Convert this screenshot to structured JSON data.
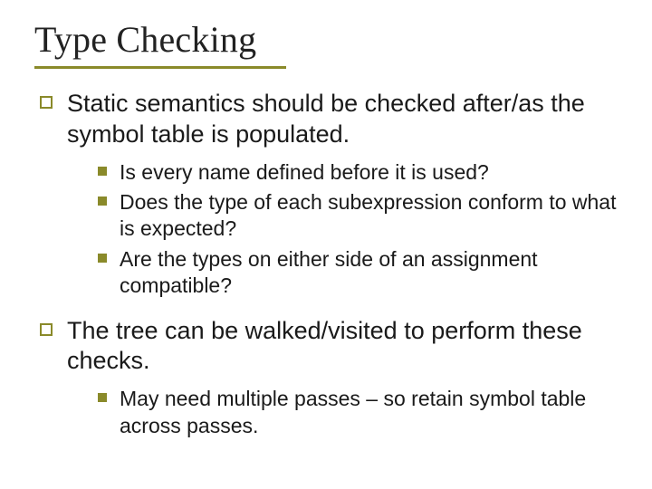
{
  "slide": {
    "title": "Type Checking",
    "points": [
      {
        "text": "Static semantics should be checked after/as the symbol table is populated.",
        "sub": [
          "Is every name defined before it is used?",
          "Does the type of each subexpression conform to what is expected?",
          "Are the types on either side of an assignment compatible?"
        ]
      },
      {
        "text": "The tree can be walked/visited to perform these checks.",
        "sub": [
          "May need multiple passes – so retain symbol table across passes."
        ]
      }
    ]
  }
}
